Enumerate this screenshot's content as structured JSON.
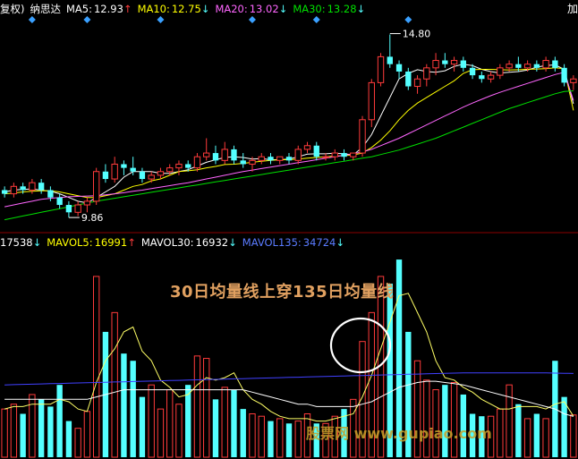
{
  "header": {
    "fq_label": "复权)",
    "stock_name": "纳思达",
    "ma5_label": "MA5:",
    "ma5_value": "12.93",
    "ma5_arrow": "↑",
    "ma10_label": "MA10:",
    "ma10_value": "12.75",
    "ma10_arrow": "↓",
    "ma20_label": "MA20:",
    "ma20_value": "13.02",
    "ma20_arrow": "↓",
    "ma30_label": "MA30:",
    "ma30_value": "13.28",
    "ma30_arrow": "↓",
    "right_cut": "加"
  },
  "volume_header": {
    "vol_value": "17538",
    "vol_arrow": "↓",
    "mavol5_label": "MAVOL5:",
    "mavol5_value": "16991",
    "mavol5_arrow": "↑",
    "mavol30_label": "MAVOL30:",
    "mavol30_value": "16932",
    "mavol30_arrow": "↓",
    "mavol135_label": "MAVOL135:",
    "mavol135_value": "34724",
    "mavol135_arrow": "↓"
  },
  "annotation": {
    "title": "30日均量线上穿135日均量线",
    "high_label": "14.80",
    "low_label": "9.86"
  },
  "watermark": "股票网 www.gupiao.com",
  "colors": {
    "up": "#ff3b3b",
    "down": "#54ffff",
    "ma5": "#ffffff",
    "ma10": "#ffff00",
    "ma20": "#ff66ff",
    "ma30": "#00e000",
    "mavol135": "#4040ff",
    "mavol30": "#ffff66"
  },
  "chart_data": [
    {
      "type": "candlestick",
      "title": "纳思达",
      "candles": [
        [
          10.6,
          10.7,
          10.4,
          10.5
        ],
        [
          10.5,
          10.8,
          10.4,
          10.7
        ],
        [
          10.7,
          10.8,
          10.5,
          10.6
        ],
        [
          10.6,
          10.9,
          10.5,
          10.8
        ],
        [
          10.8,
          10.9,
          10.5,
          10.6
        ],
        [
          10.6,
          10.7,
          10.3,
          10.4
        ],
        [
          10.4,
          10.5,
          10.1,
          10.2
        ],
        [
          10.2,
          10.3,
          9.86,
          10.0
        ],
        [
          10.0,
          10.3,
          9.9,
          10.2
        ],
        [
          10.2,
          10.4,
          10.0,
          10.3
        ],
        [
          10.3,
          11.2,
          10.2,
          11.1
        ],
        [
          11.1,
          11.3,
          10.8,
          10.9
        ],
        [
          10.9,
          11.5,
          10.8,
          11.3
        ],
        [
          11.3,
          11.4,
          11.0,
          11.2
        ],
        [
          11.2,
          11.5,
          11.0,
          11.1
        ],
        [
          11.1,
          11.2,
          10.8,
          10.9
        ],
        [
          10.9,
          11.1,
          10.8,
          11.0
        ],
        [
          11.0,
          11.2,
          10.9,
          11.1
        ],
        [
          11.1,
          11.3,
          11.0,
          11.2
        ],
        [
          11.2,
          11.4,
          11.0,
          11.3
        ],
        [
          11.3,
          11.4,
          11.1,
          11.2
        ],
        [
          11.2,
          11.6,
          11.1,
          11.5
        ],
        [
          11.5,
          12.0,
          11.4,
          11.6
        ],
        [
          11.6,
          11.8,
          11.3,
          11.4
        ],
        [
          11.4,
          11.9,
          11.3,
          11.7
        ],
        [
          11.7,
          11.8,
          11.3,
          11.4
        ],
        [
          11.4,
          11.6,
          11.2,
          11.3
        ],
        [
          11.3,
          11.5,
          11.1,
          11.4
        ],
        [
          11.4,
          11.6,
          11.3,
          11.5
        ],
        [
          11.5,
          11.6,
          11.3,
          11.4
        ],
        [
          11.4,
          11.5,
          11.3,
          11.5
        ],
        [
          11.5,
          11.6,
          11.3,
          11.4
        ],
        [
          11.4,
          11.8,
          11.3,
          11.7
        ],
        [
          11.7,
          11.9,
          11.6,
          11.8
        ],
        [
          11.8,
          11.9,
          11.4,
          11.5
        ],
        [
          11.5,
          11.6,
          11.4,
          11.5
        ],
        [
          11.5,
          11.7,
          11.4,
          11.6
        ],
        [
          11.6,
          11.7,
          11.4,
          11.5
        ],
        [
          11.5,
          11.6,
          11.4,
          11.6
        ],
        [
          11.6,
          12.6,
          11.5,
          12.5
        ],
        [
          12.5,
          13.6,
          12.3,
          13.5
        ],
        [
          13.5,
          14.3,
          13.4,
          14.2
        ],
        [
          14.2,
          14.8,
          13.9,
          14.0
        ],
        [
          14.0,
          14.1,
          13.6,
          13.8
        ],
        [
          13.8,
          13.9,
          13.3,
          13.4
        ],
        [
          13.4,
          13.7,
          13.2,
          13.6
        ],
        [
          13.6,
          14.0,
          13.4,
          13.9
        ],
        [
          13.9,
          14.3,
          13.7,
          14.1
        ],
        [
          14.1,
          14.3,
          13.9,
          14.0
        ],
        [
          14.0,
          14.2,
          13.8,
          14.1
        ],
        [
          14.1,
          14.2,
          13.8,
          13.9
        ],
        [
          13.9,
          14.0,
          13.6,
          13.7
        ],
        [
          13.7,
          13.8,
          13.5,
          13.6
        ],
        [
          13.6,
          13.8,
          13.5,
          13.7
        ],
        [
          13.7,
          14.0,
          13.6,
          13.9
        ],
        [
          13.9,
          14.1,
          13.8,
          14.0
        ],
        [
          14.0,
          14.2,
          13.8,
          13.9
        ],
        [
          13.9,
          14.1,
          13.8,
          14.0
        ],
        [
          14.0,
          14.1,
          13.8,
          13.9
        ],
        [
          13.9,
          14.2,
          13.8,
          14.1
        ],
        [
          14.1,
          14.2,
          13.8,
          13.9
        ],
        [
          13.9,
          14.0,
          13.4,
          13.5
        ],
        [
          13.5,
          13.7,
          13.3,
          13.6
        ]
      ],
      "ma": {
        "MA5": [
          10.55,
          10.6,
          10.62,
          10.63,
          10.6,
          10.57,
          10.5,
          10.4,
          10.3,
          10.25,
          10.4,
          10.55,
          10.7,
          10.95,
          11.1,
          11.1,
          11.1,
          11.05,
          11.05,
          11.1,
          11.15,
          11.25,
          11.35,
          11.42,
          11.48,
          11.5,
          11.48,
          11.44,
          11.45,
          11.42,
          11.42,
          11.44,
          11.5,
          11.57,
          11.58,
          11.58,
          11.6,
          11.58,
          11.55,
          11.75,
          12.1,
          12.6,
          13.1,
          13.6,
          13.75,
          13.85,
          13.8,
          13.78,
          13.82,
          13.94,
          14.0,
          13.96,
          13.86,
          13.8,
          13.76,
          13.78,
          13.8,
          13.84,
          13.92,
          13.96,
          13.98,
          13.86,
          12.93
        ],
        "MA10": [
          10.5,
          10.52,
          10.55,
          10.57,
          10.58,
          10.58,
          10.55,
          10.5,
          10.45,
          10.4,
          10.4,
          10.45,
          10.5,
          10.6,
          10.7,
          10.75,
          10.85,
          10.9,
          11.0,
          11.1,
          11.12,
          11.15,
          11.2,
          11.24,
          11.29,
          11.3,
          11.32,
          11.35,
          11.38,
          11.4,
          11.42,
          11.42,
          11.44,
          11.46,
          11.48,
          11.5,
          11.52,
          11.53,
          11.55,
          11.6,
          11.75,
          11.95,
          12.2,
          12.5,
          12.75,
          12.95,
          13.1,
          13.25,
          13.4,
          13.55,
          13.75,
          13.85,
          13.86,
          13.86,
          13.85,
          13.84,
          13.85,
          13.86,
          13.87,
          13.88,
          13.9,
          13.88,
          12.75
        ],
        "MA20": [
          10.15,
          10.2,
          10.25,
          10.3,
          10.35,
          10.38,
          10.4,
          10.42,
          10.43,
          10.44,
          10.45,
          10.47,
          10.5,
          10.53,
          10.57,
          10.6,
          10.64,
          10.68,
          10.72,
          10.76,
          10.8,
          10.85,
          10.9,
          10.95,
          11.0,
          11.05,
          11.1,
          11.14,
          11.18,
          11.22,
          11.26,
          11.3,
          11.34,
          11.38,
          11.42,
          11.46,
          11.5,
          11.54,
          11.58,
          11.63,
          11.7,
          11.8,
          11.9,
          12.0,
          12.12,
          12.24,
          12.36,
          12.48,
          12.6,
          12.72,
          12.84,
          12.95,
          13.05,
          13.15,
          13.24,
          13.32,
          13.4,
          13.48,
          13.56,
          13.64,
          13.72,
          13.78,
          13.02
        ],
        "MA30": [
          9.8,
          9.85,
          9.9,
          9.95,
          10.0,
          10.05,
          10.1,
          10.15,
          10.2,
          10.25,
          10.3,
          10.34,
          10.38,
          10.42,
          10.46,
          10.5,
          10.54,
          10.58,
          10.62,
          10.66,
          10.7,
          10.74,
          10.78,
          10.82,
          10.86,
          10.9,
          10.94,
          10.98,
          11.02,
          11.06,
          11.1,
          11.14,
          11.18,
          11.22,
          11.26,
          11.3,
          11.34,
          11.38,
          11.42,
          11.46,
          11.5,
          11.56,
          11.62,
          11.68,
          11.76,
          11.84,
          11.92,
          12.0,
          12.1,
          12.2,
          12.3,
          12.4,
          12.5,
          12.6,
          12.7,
          12.8,
          12.88,
          12.96,
          13.04,
          13.12,
          13.2,
          13.26,
          13.28
        ]
      },
      "annotations": [
        {
          "text": "14.80",
          "type": "high",
          "value": 14.8
        },
        {
          "text": "9.86",
          "type": "low",
          "value": 9.86
        }
      ],
      "signals": [
        3,
        9,
        17,
        27,
        34,
        44
      ]
    },
    {
      "type": "bar",
      "title": "VOL",
      "values": [
        20000,
        22000,
        18000,
        26000,
        24000,
        21000,
        30000,
        15000,
        12000,
        19000,
        75000,
        52000,
        60000,
        43000,
        40000,
        25000,
        30000,
        20000,
        28000,
        22000,
        30000,
        42000,
        41000,
        24000,
        29000,
        28000,
        20000,
        18000,
        17000,
        15000,
        16000,
        14000,
        15000,
        18000,
        14000,
        14000,
        17000,
        20000,
        24000,
        48000,
        60000,
        75000,
        72000,
        82000,
        52000,
        40000,
        32000,
        28000,
        30000,
        31000,
        26000,
        18000,
        17000,
        17000,
        20000,
        30000,
        22000,
        16000,
        18000,
        16000,
        40000,
        25000,
        17538
      ],
      "up": [
        true,
        true,
        false,
        true,
        false,
        false,
        false,
        false,
        true,
        true,
        true,
        false,
        true,
        false,
        false,
        false,
        true,
        true,
        true,
        true,
        false,
        true,
        true,
        false,
        true,
        false,
        false,
        true,
        true,
        false,
        true,
        false,
        true,
        true,
        false,
        true,
        true,
        false,
        true,
        true,
        true,
        true,
        false,
        false,
        false,
        true,
        true,
        true,
        false,
        true,
        false,
        false,
        false,
        true,
        true,
        true,
        false,
        true,
        false,
        true,
        false,
        false,
        true
      ],
      "series": [
        {
          "name": "MAVOL5",
          "values": [
            20000,
            21000,
            21000,
            22000,
            22000,
            22000,
            24000,
            23000,
            20000,
            19000,
            31000,
            40000,
            45000,
            52000,
            54000,
            44000,
            40000,
            32000,
            29000,
            25000,
            26000,
            30000,
            33000,
            32000,
            33000,
            35000,
            28000,
            24000,
            22000,
            19000,
            17000,
            16000,
            16000,
            16000,
            15000,
            15000,
            16000,
            17000,
            18000,
            25000,
            34000,
            45000,
            56000,
            67000,
            68000,
            60000,
            52000,
            40000,
            33000,
            32000,
            29000,
            27000,
            24000,
            22000,
            20000,
            20000,
            21000,
            21000,
            21000,
            20000,
            22000,
            23000,
            16991
          ]
        },
        {
          "name": "MAVOL30",
          "values": [
            24000,
            24000,
            24000,
            24000,
            24000,
            24000,
            24000,
            24000,
            24000,
            24000,
            25000,
            26000,
            27000,
            28000,
            28000,
            28000,
            28000,
            28000,
            28000,
            28000,
            28000,
            28000,
            28000,
            28000,
            28000,
            28000,
            28000,
            27000,
            26000,
            25000,
            24000,
            23000,
            22000,
            22000,
            21000,
            21000,
            21000,
            21000,
            21000,
            22000,
            23000,
            25000,
            27000,
            29000,
            30000,
            31000,
            31500,
            31500,
            31000,
            30500,
            30000,
            29000,
            28000,
            27000,
            26000,
            25000,
            24000,
            23000,
            22000,
            21000,
            20000,
            18000,
            16932
          ]
        },
        {
          "name": "MAVOL135",
          "values": [
            30000,
            30100,
            30200,
            30300,
            30400,
            30500,
            30600,
            30700,
            30800,
            30900,
            31000,
            31100,
            31200,
            31300,
            31400,
            31500,
            31600,
            31700,
            31800,
            31900,
            32000,
            32100,
            32200,
            32300,
            32400,
            32500,
            32600,
            32700,
            32800,
            32900,
            33000,
            33100,
            33200,
            33300,
            33400,
            33500,
            33600,
            33700,
            33800,
            33900,
            34000,
            34100,
            34200,
            34300,
            34400,
            34500,
            34600,
            34700,
            34800,
            34900,
            35000,
            35000,
            35000,
            35000,
            35000,
            35000,
            35000,
            35000,
            35000,
            35000,
            34900,
            34800,
            34724
          ]
        }
      ],
      "ylim": [
        0,
        85000
      ]
    }
  ]
}
